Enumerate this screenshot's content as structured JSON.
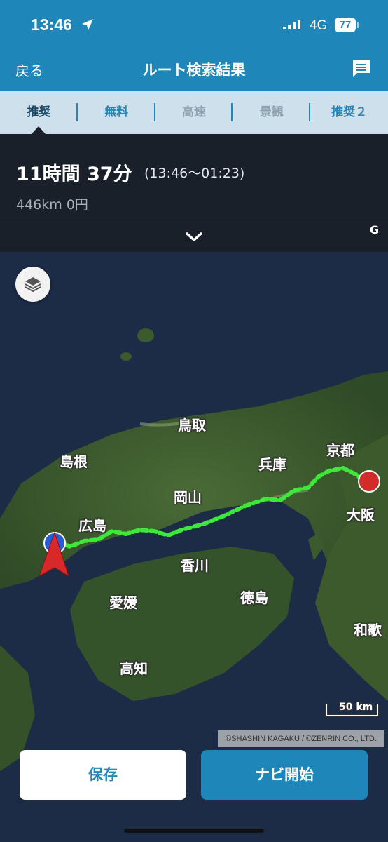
{
  "status_bar": {
    "time": "13:46",
    "network": "4G",
    "battery": "77"
  },
  "header": {
    "back_label": "戻る",
    "title": "ルート検索結果"
  },
  "tabs": [
    {
      "label": "推奨",
      "state": "active"
    },
    {
      "label": "無料",
      "state": "enabled"
    },
    {
      "label": "高速",
      "state": "disabled"
    },
    {
      "label": "景観",
      "state": "disabled"
    },
    {
      "label": "推奨２",
      "state": "enabled"
    }
  ],
  "summary": {
    "duration": "11時間 37分",
    "time_range": "(13:46～01:23)",
    "distance_cost": "446km  0円"
  },
  "map": {
    "prefecture_labels": [
      "鳥取",
      "島根",
      "京都",
      "兵庫",
      "岡山",
      "大阪",
      "広島",
      "香川",
      "徳島",
      "愛媛",
      "和歌",
      "高知"
    ],
    "scale_label": "50 km",
    "copyright": "©SHASHIN KAGAKU / ©ZENRIN CO., LTD.",
    "goal_marker": "G",
    "route_color": "#3ee83a"
  },
  "actions": {
    "save_label": "保存",
    "start_nav_label": "ナビ開始"
  },
  "colors": {
    "header": "#1e86b8",
    "tabs_bg": "#cde0ec",
    "summary_bg": "#1a2029"
  }
}
